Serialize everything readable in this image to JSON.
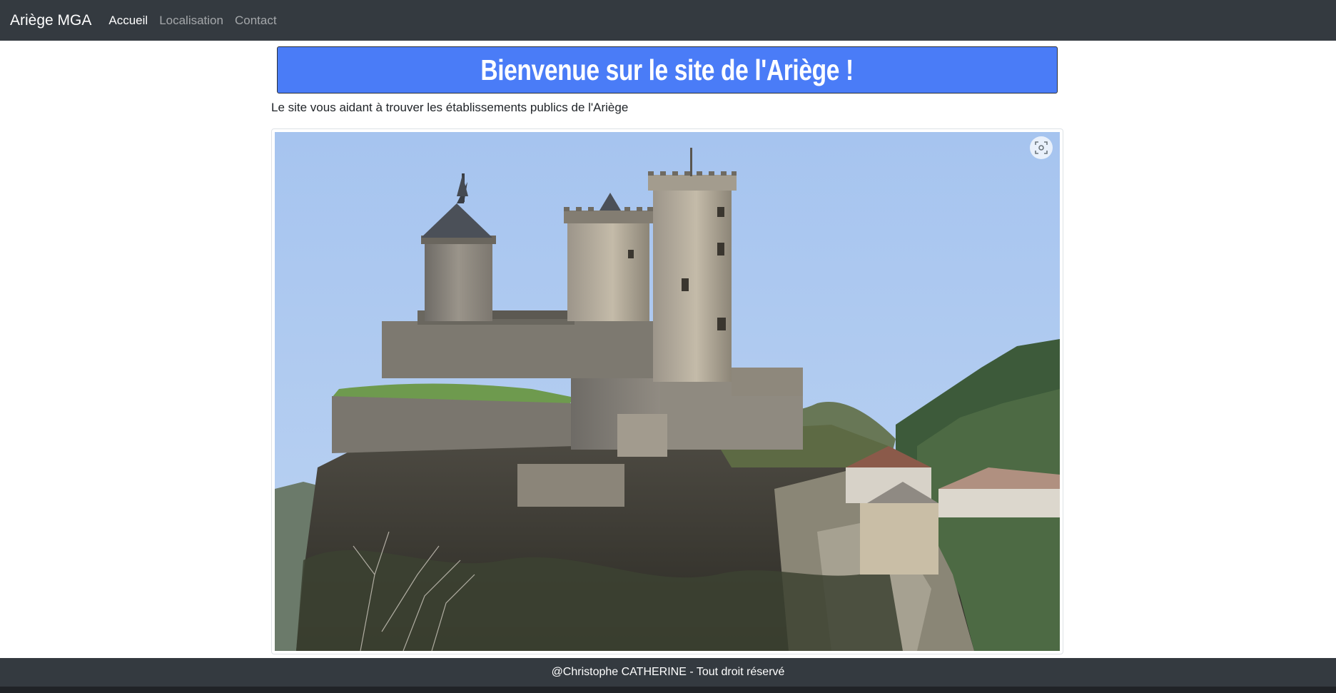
{
  "navbar": {
    "brand": "Ariège MGA",
    "links": [
      {
        "label": "Accueil",
        "active": true
      },
      {
        "label": "Localisation",
        "active": false
      },
      {
        "label": "Contact",
        "active": false
      }
    ]
  },
  "banner": {
    "title": "Bienvenue sur le site de l'Ariège !"
  },
  "intro": {
    "text": "Le site vous aidant à trouver les établissements publics de l'Ariège"
  },
  "image": {
    "icon": "visual-search-icon"
  },
  "footer": {
    "text": "@Christophe CATHERINE - Tout droit réservé"
  },
  "colors": {
    "navbar": "#343a40",
    "banner": "#4a7cf7",
    "sky": "#a9c6ee"
  }
}
